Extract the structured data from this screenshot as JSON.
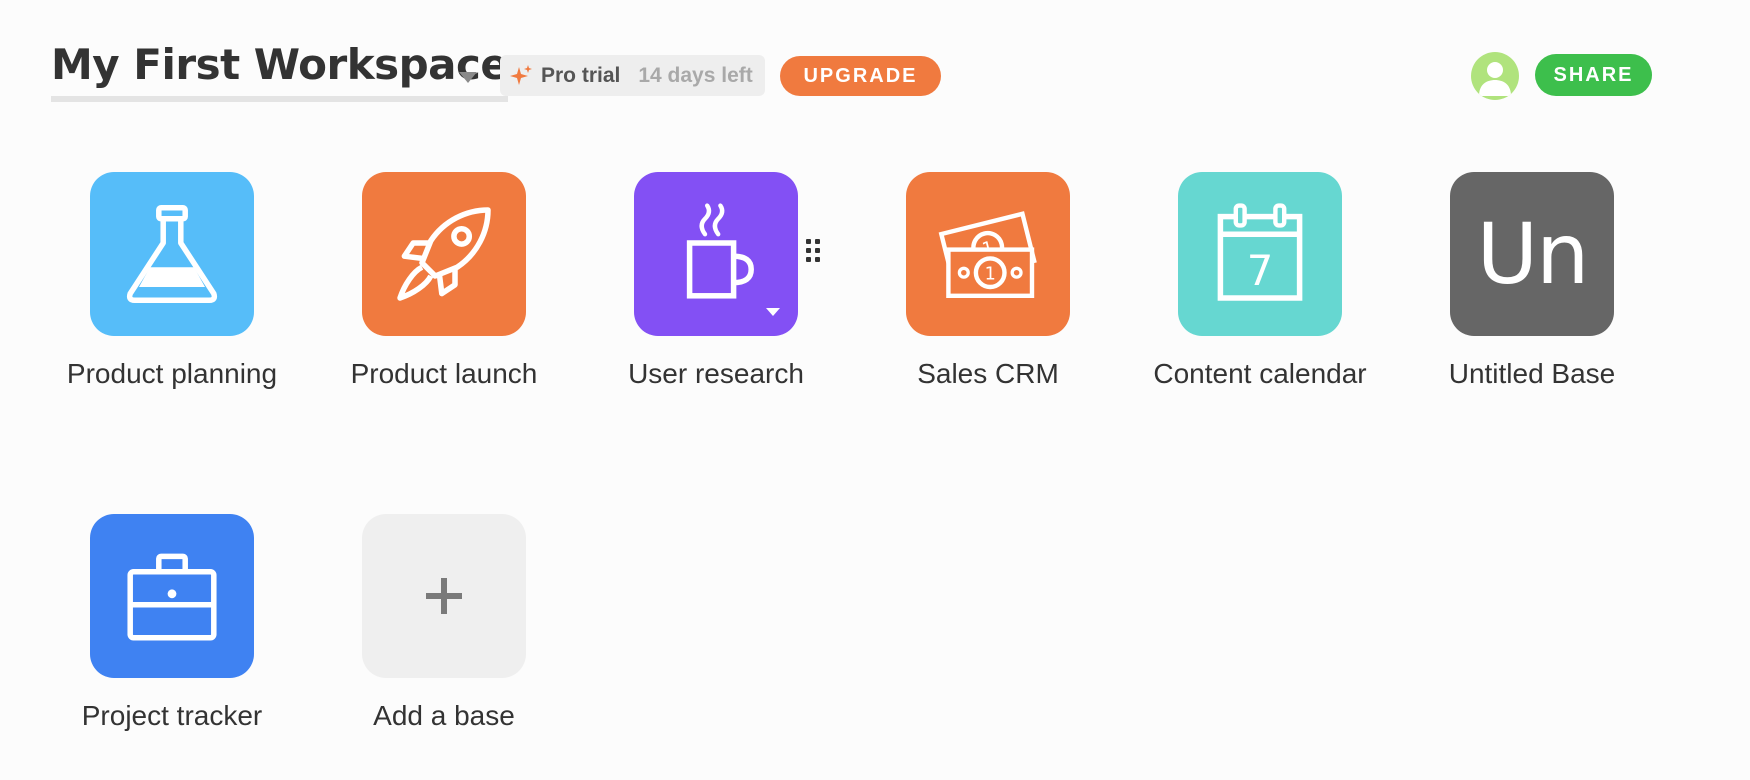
{
  "workspace": {
    "title": "My First Workspace"
  },
  "trial": {
    "label": "Pro trial",
    "days_left": "14 days left"
  },
  "buttons": {
    "upgrade": "UPGRADE",
    "share": "SHARE"
  },
  "bases": [
    {
      "label": "Product planning",
      "color": "#56bdf9",
      "icon": "flask-icon"
    },
    {
      "label": "Product launch",
      "color": "#f07a3f",
      "icon": "rocket-icon"
    },
    {
      "label": "User research",
      "color": "#8350f4",
      "icon": "coffee-mug-icon"
    },
    {
      "label": "Sales CRM",
      "color": "#f07a3f",
      "icon": "money-icon"
    },
    {
      "label": "Content calendar",
      "color": "#66d7d1",
      "icon": "calendar-icon",
      "date": "7"
    },
    {
      "label": "Untitled Base",
      "color": "#666666",
      "abbr": "Un"
    },
    {
      "label": "Project tracker",
      "color": "#3f82f2",
      "icon": "briefcase-icon"
    },
    {
      "label": "Add a base",
      "color": "#efefef",
      "icon": "plus-icon"
    }
  ]
}
